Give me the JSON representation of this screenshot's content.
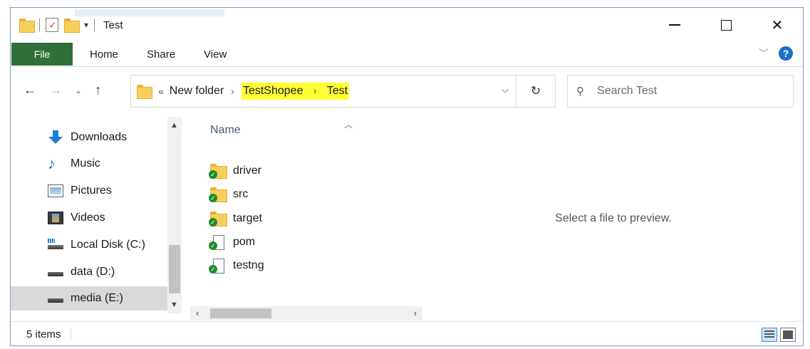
{
  "window": {
    "title": "Test",
    "controls": {
      "minimize": "—",
      "maximize": "☐",
      "close": "✕"
    }
  },
  "ribbon": {
    "tabs": [
      "File",
      "Home",
      "Share",
      "View"
    ],
    "help": "?"
  },
  "address": {
    "overflow": "«",
    "crumbs": [
      "New folder",
      "TestShopee",
      "Test"
    ],
    "separator": "›",
    "highlight_color": "#ffff33"
  },
  "search": {
    "placeholder": "Search Test"
  },
  "nav_pane": {
    "items": [
      {
        "label": "Downloads",
        "icon": "download-icon"
      },
      {
        "label": "Music",
        "icon": "music-icon"
      },
      {
        "label": "Pictures",
        "icon": "pictures-icon"
      },
      {
        "label": "Videos",
        "icon": "videos-icon"
      },
      {
        "label": "Local Disk (C:)",
        "icon": "local-disk-icon"
      },
      {
        "label": "data (D:)",
        "icon": "drive-icon"
      },
      {
        "label": "media (E:)",
        "icon": "drive-icon",
        "selected": true
      }
    ]
  },
  "file_list": {
    "column": "Name",
    "files": [
      {
        "name": "driver",
        "type": "folder"
      },
      {
        "name": "src",
        "type": "folder"
      },
      {
        "name": "target",
        "type": "folder"
      },
      {
        "name": "pom",
        "type": "file"
      },
      {
        "name": "testng",
        "type": "file"
      }
    ]
  },
  "preview": {
    "text": "Select a file to preview."
  },
  "status": {
    "items": "5 items"
  },
  "colors": {
    "file_tab": "#2f6f3a",
    "accent": "#1e7ed4",
    "sync_check": "#1e8c2c"
  }
}
